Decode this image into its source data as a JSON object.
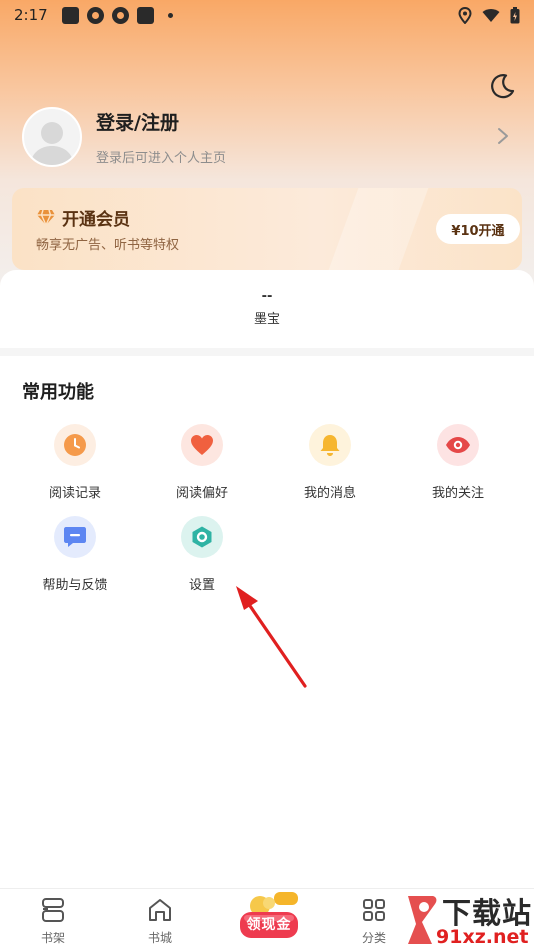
{
  "status_bar": {
    "time": "2:17"
  },
  "profile": {
    "title": "登录/注册",
    "subtitle": "登录后可进入个人主页"
  },
  "vip": {
    "title": "开通会员",
    "subtitle": "畅享无广告、听书等特权",
    "button_label": "¥10开通"
  },
  "mobao": {
    "value": "--",
    "label": "墨宝"
  },
  "functions": {
    "title": "常用功能",
    "items": [
      {
        "label": "阅读记录",
        "icon": "clock-icon",
        "color": "#f59a4b"
      },
      {
        "label": "阅读偏好",
        "icon": "heart-icon",
        "color": "#f0603f"
      },
      {
        "label": "我的消息",
        "icon": "bell-icon",
        "color": "#f6b630"
      },
      {
        "label": "我的关注",
        "icon": "eye-icon",
        "color": "#e54848"
      },
      {
        "label": "帮助与反馈",
        "icon": "chat-icon",
        "color": "#5d86f2"
      },
      {
        "label": "设置",
        "icon": "gear-icon",
        "color": "#2fb3a4"
      }
    ]
  },
  "bottom_nav": {
    "items": [
      {
        "label": "书架",
        "icon": "bookshelf-icon"
      },
      {
        "label": "书城",
        "icon": "home-icon"
      },
      {
        "label": "领现金",
        "icon": "cash-promo-icon"
      },
      {
        "label": "分类",
        "icon": "grid-icon"
      }
    ]
  },
  "watermark": {
    "text": "下载站",
    "url_text": "91xz.net"
  },
  "colors": {
    "accent": "#f9a866",
    "arrow": "#e02020"
  }
}
